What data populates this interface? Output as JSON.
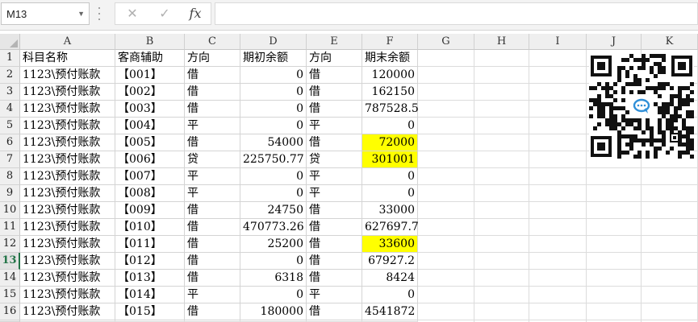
{
  "formula_bar": {
    "name_box": "M13",
    "cancel_icon": "✕",
    "confirm_icon": "✓",
    "fx_label": "fx",
    "formula": ""
  },
  "columns": [
    "A",
    "B",
    "C",
    "D",
    "E",
    "F",
    "G",
    "H",
    "I",
    "J",
    "K"
  ],
  "header_row": {
    "row_number": "1",
    "A": "科目名称",
    "B": "客商辅助",
    "C": "方向",
    "D": "期初余额",
    "E": "方向",
    "F": "期末余额"
  },
  "rows": [
    {
      "n": "2",
      "A": "1123\\预付账款",
      "B": "【001】",
      "C": "借",
      "D": "0",
      "E": "借",
      "F": "120000",
      "hl": false
    },
    {
      "n": "3",
      "A": "1123\\预付账款",
      "B": "【002】",
      "C": "借",
      "D": "0",
      "E": "借",
      "F": "162150",
      "hl": false
    },
    {
      "n": "4",
      "A": "1123\\预付账款",
      "B": "【003】",
      "C": "借",
      "D": "0",
      "E": "借",
      "F": "787528.5",
      "hl": false
    },
    {
      "n": "5",
      "A": "1123\\预付账款",
      "B": "【004】",
      "C": "平",
      "D": "0",
      "E": "平",
      "F": "0",
      "hl": false
    },
    {
      "n": "6",
      "A": "1123\\预付账款",
      "B": "【005】",
      "C": "借",
      "D": "54000",
      "E": "借",
      "F": "72000",
      "hl": true
    },
    {
      "n": "7",
      "A": "1123\\预付账款",
      "B": "【006】",
      "C": "贷",
      "D": "225750.77",
      "E": "贷",
      "F": "301001",
      "hl": true
    },
    {
      "n": "8",
      "A": "1123\\预付账款",
      "B": "【007】",
      "C": "平",
      "D": "0",
      "E": "平",
      "F": "0",
      "hl": false
    },
    {
      "n": "9",
      "A": "1123\\预付账款",
      "B": "【008】",
      "C": "平",
      "D": "0",
      "E": "平",
      "F": "0",
      "hl": false
    },
    {
      "n": "10",
      "A": "1123\\预付账款",
      "B": "【009】",
      "C": "借",
      "D": "24750",
      "E": "借",
      "F": "33000",
      "hl": false
    },
    {
      "n": "11",
      "A": "1123\\预付账款",
      "B": "【010】",
      "C": "借",
      "D": "470773.26",
      "E": "借",
      "F": "627697.7",
      "hl": false
    },
    {
      "n": "12",
      "A": "1123\\预付账款",
      "B": "【011】",
      "C": "借",
      "D": "25200",
      "E": "借",
      "F": "33600",
      "hl": true
    },
    {
      "n": "13",
      "A": "1123\\预付账款",
      "B": "【012】",
      "C": "借",
      "D": "0",
      "E": "借",
      "F": "67927.2",
      "hl": false
    },
    {
      "n": "14",
      "A": "1123\\预付账款",
      "B": "【013】",
      "C": "借",
      "D": "6318",
      "E": "借",
      "F": "8424",
      "hl": false
    },
    {
      "n": "15",
      "A": "1123\\预付账款",
      "B": "【014】",
      "C": "平",
      "D": "0",
      "E": "平",
      "F": "0",
      "hl": false
    },
    {
      "n": "16",
      "A": "1123\\预付账款",
      "B": "【015】",
      "C": "借",
      "D": "180000",
      "E": "借",
      "F": "4541872",
      "hl": false
    }
  ],
  "selected_row": "13",
  "colors": {
    "highlight": "#ffff00",
    "selection_accent": "#217346",
    "gridline": "#d4d4d4"
  },
  "qr_code": {
    "icon": "qr-code-icon",
    "center_icon": "chat-bubble-icon"
  }
}
